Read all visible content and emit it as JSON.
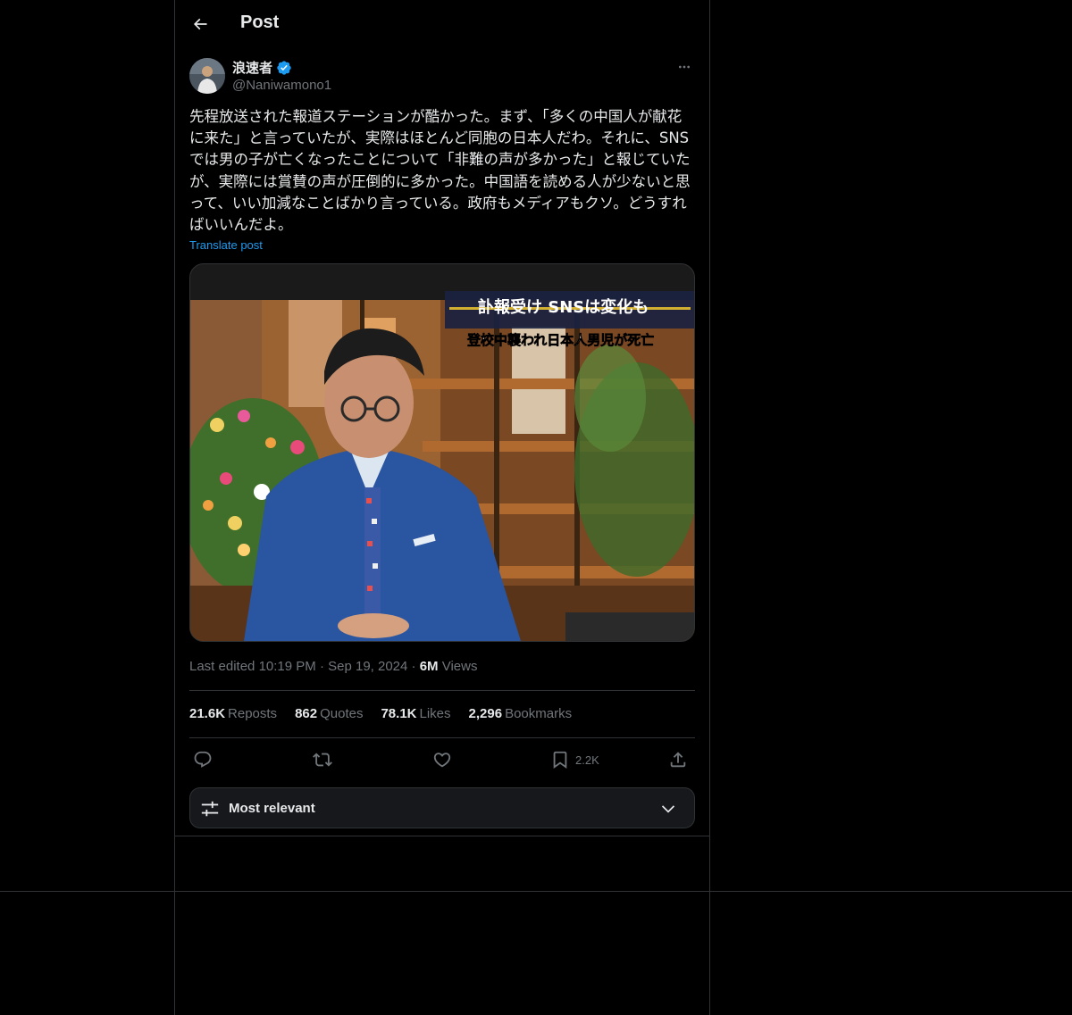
{
  "header": {
    "title": "Post"
  },
  "post": {
    "author": {
      "display_name": "浪速者",
      "handle": "@Naniwamono1",
      "verified": true
    },
    "text": "先程放送された報道ステーションが酷かった。まず、「多くの中国人が献花に来た」と言っていたが、実際はほとんど同胞の日本人だわ。それに、SNSでは男の子が亡くなったことについて「非難の声が多かった」と報じていたが、実際には賞賛の声が圧倒的に多かった。中国語を読める人が少ないと思って、いい加減なことばかり言っている。政府もメディアもクソ。どうすればいいんだよ。",
    "translate_label": "Translate post",
    "media": {
      "caption_line1": "訃報受け SNSは変化も",
      "caption_line2": "登校中襲われ日本人男児が死亡"
    },
    "meta": {
      "edited_prefix": "Last edited",
      "time": "10:19 PM",
      "separator": "·",
      "date": "Sep 19, 2024",
      "views_count": "6M",
      "views_label": "Views"
    },
    "stats": {
      "reposts_count": "21.6K",
      "reposts_label": "Reposts",
      "quotes_count": "862",
      "quotes_label": "Quotes",
      "likes_count": "78.1K",
      "likes_label": "Likes",
      "bookmarks_count": "2,296",
      "bookmarks_label": "Bookmarks"
    },
    "actions": {
      "bookmark_count": "2.2K"
    }
  },
  "replies_sort": {
    "label": "Most relevant"
  },
  "colors": {
    "background": "#000000",
    "border": "#2f3336",
    "text_primary": "#e7e9ea",
    "text_secondary": "#71767b",
    "accent": "#1d9bf0"
  }
}
